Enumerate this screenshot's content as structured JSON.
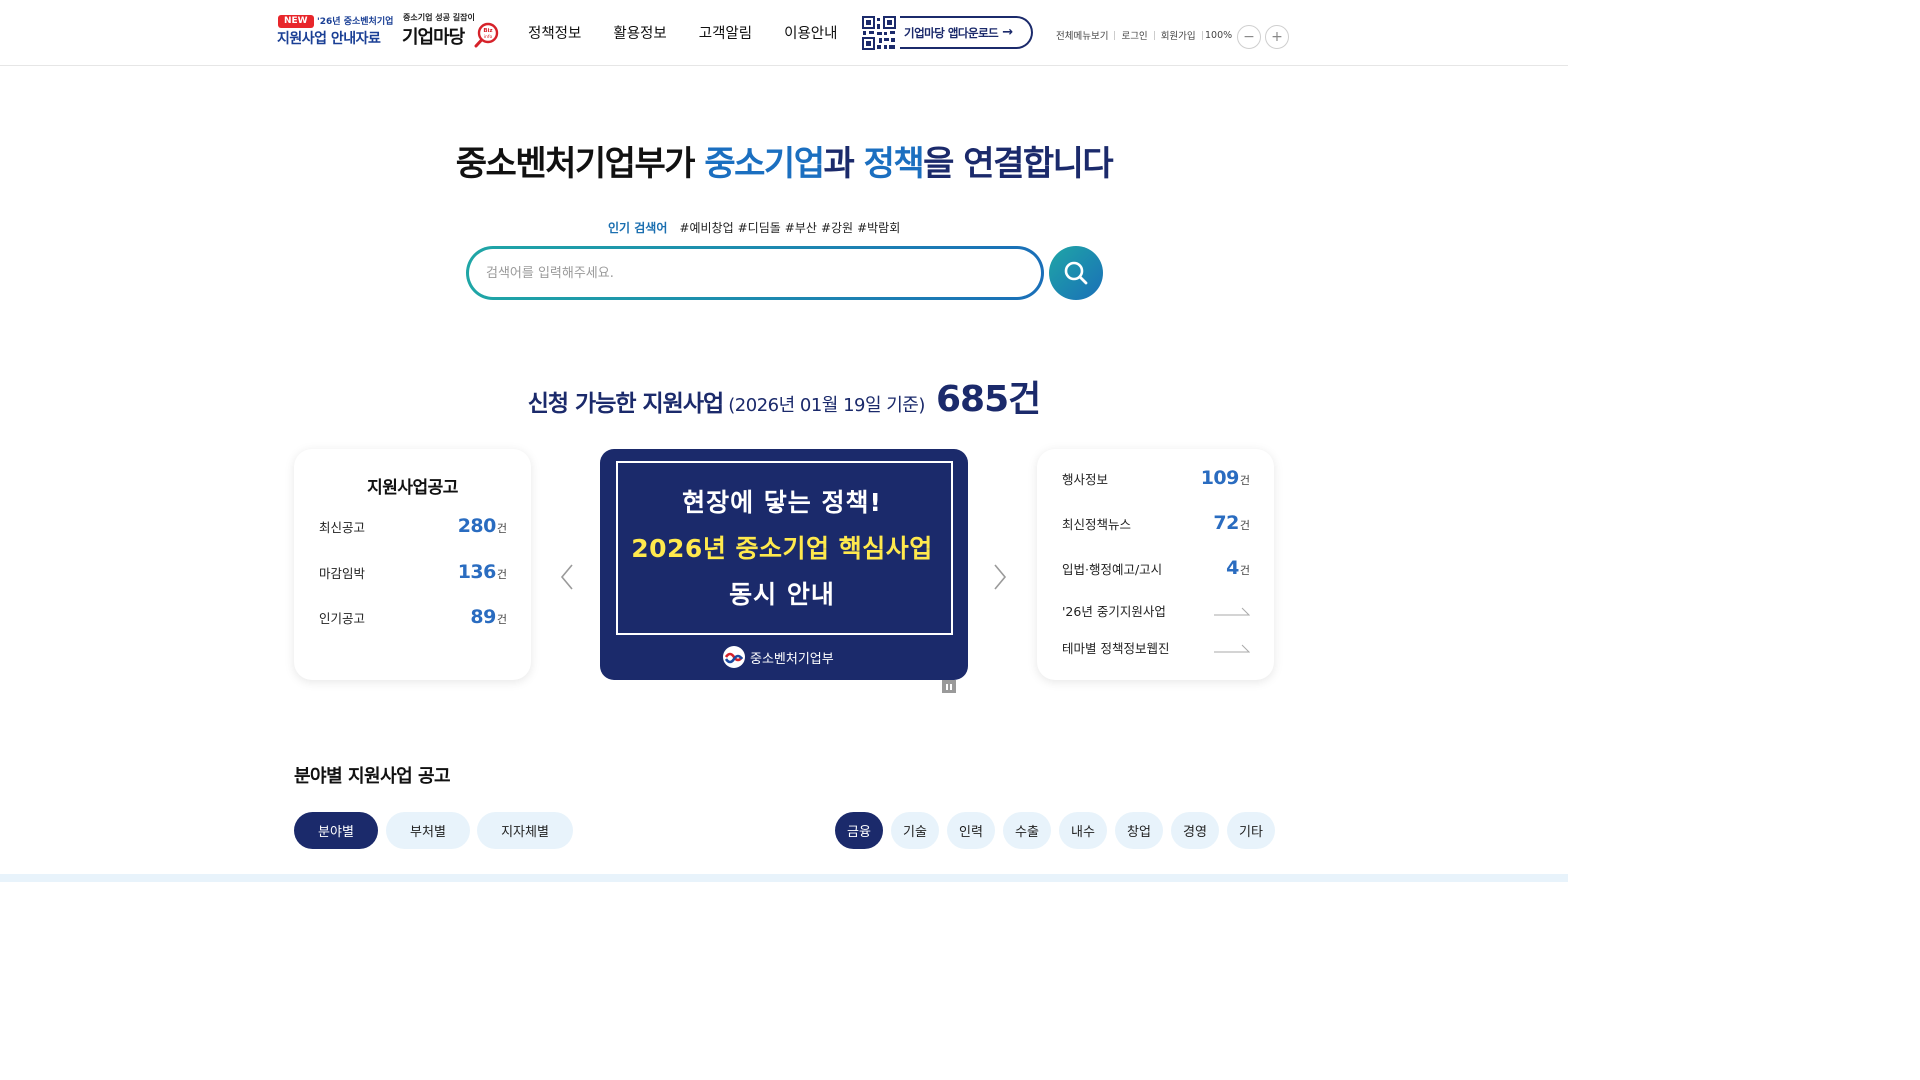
{
  "header": {
    "notice_logo": {
      "badge": "NEW",
      "year_text": "'26년 중소벤처기업",
      "main_text": "지원사업 안내자료"
    },
    "brand_logo": {
      "sub_text": "중소기업 성공 길잡이",
      "main_text": "기업마당",
      "mark_text": "Biz info"
    },
    "nav": [
      "정책정보",
      "활용정보",
      "고객알림",
      "이용안내"
    ],
    "app_download": "기업마당 앱다운로드",
    "util_links": [
      "전체메뉴보기",
      "로그인",
      "회원가입"
    ],
    "zoom": "100%",
    "zoom_out": "−",
    "zoom_in": "+"
  },
  "hero": {
    "title_prefix": "중소벤처기업부가 ",
    "title_hl1": "중소기업",
    "title_mid": "과 ",
    "title_hl2": "정책",
    "title_suffix": "을 연결합니다",
    "popular_label": "인기 검색어",
    "popular_tags": [
      "#예비창업",
      "#디딤돌",
      "#부산",
      "#강원",
      "#박람회"
    ],
    "search_placeholder": "검색어를 입력해주세요."
  },
  "summary": {
    "title": "신청 가능한 지원사업",
    "date_note": "(2026년 01월 19일 기준)",
    "count": "685건"
  },
  "left_card": {
    "title": "지원사업공고",
    "stats": [
      {
        "label": "최신공고",
        "value": "280",
        "unit": "건"
      },
      {
        "label": "마감임박",
        "value": "136",
        "unit": "건"
      },
      {
        "label": "인기공고",
        "value": "89",
        "unit": "건"
      }
    ]
  },
  "banner": {
    "line1": "현장에 닿는 정책!",
    "line2": "2026년 중소기업 핵심사업",
    "line3": "동시 안내",
    "org": "중소벤처기업부",
    "colors": {
      "bg": "#1b2a6b",
      "highlight": "#ffe94d"
    }
  },
  "right_card": {
    "stats": [
      {
        "label": "행사정보",
        "value": "109",
        "unit": "건"
      },
      {
        "label": "최신정책뉴스",
        "value": "72",
        "unit": "건"
      },
      {
        "label": "입법·행정예고/고시",
        "value": "4",
        "unit": "건"
      }
    ],
    "links": [
      "'26년 중기지원사업",
      "테마별 정책정보웹진"
    ]
  },
  "category": {
    "title": "분야별 지원사업 공고",
    "view_tabs": [
      "분야별",
      "부처별",
      "지자체별"
    ],
    "active_view": "분야별",
    "fields": [
      "금융",
      "기술",
      "인력",
      "수출",
      "내수",
      "창업",
      "경영",
      "기타"
    ],
    "active_field": "금융"
  },
  "colors": {
    "navy": "#1b2a6b",
    "accent_blue": "#1b6fc0",
    "teal": "#1fa6a6",
    "pill_bg": "#e8f3fb"
  }
}
